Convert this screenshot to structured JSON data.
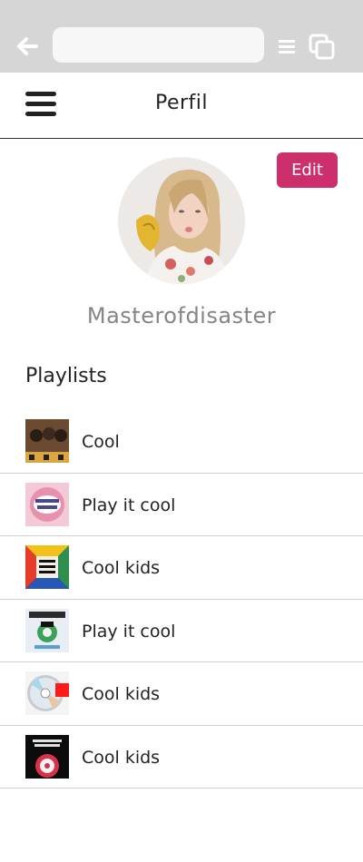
{
  "browser": {
    "url": "",
    "icons": [
      "back-arrow-icon",
      "menu-lines-icon",
      "tabs-icon"
    ]
  },
  "header": {
    "menu_icon": "hamburger-icon",
    "title": "Perfil"
  },
  "profile": {
    "edit_label": "Edit",
    "edit_color": "#cd2f6d",
    "username": "Masterofdisaster"
  },
  "playlists": {
    "heading": "Playlists",
    "items": [
      {
        "name": "Cool"
      },
      {
        "name": "Play it cool"
      },
      {
        "name": "Cool kids"
      },
      {
        "name": "Play it cool"
      },
      {
        "name": "Cool kids"
      },
      {
        "name": "Cool kids"
      }
    ]
  }
}
